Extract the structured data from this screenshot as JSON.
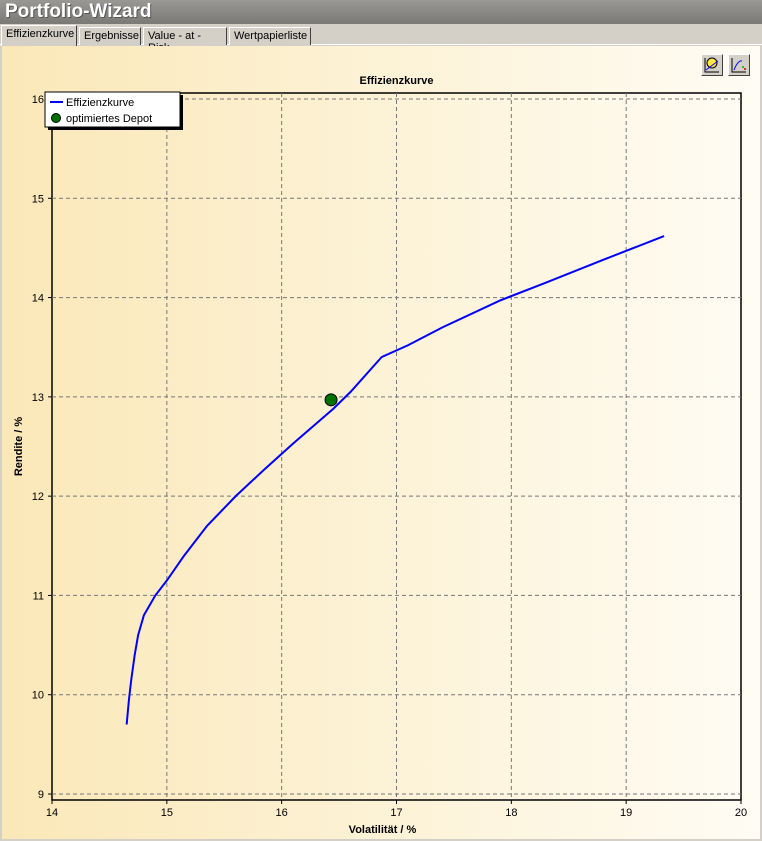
{
  "window": {
    "title": "Portfolio-Wizard"
  },
  "tabs": [
    {
      "label": "Effizienzkurve",
      "active": true
    },
    {
      "label": "Ergebnisse"
    },
    {
      "label": "Value - at - Risk"
    },
    {
      "label": "Wertpapierliste"
    }
  ],
  "toolbar": {
    "buttons": [
      {
        "icon": "chart-edit-icon"
      },
      {
        "icon": "chart-type-icon"
      }
    ]
  },
  "colors": {
    "curve": "#0000ff",
    "marker": "#007000"
  },
  "chart_data": {
    "type": "line",
    "title": "Effizienzkurve",
    "xlabel": "Volatilität / %",
    "ylabel": "Rendite / %",
    "xlim": [
      14,
      20
    ],
    "ylim": [
      9,
      16
    ],
    "xticks": [
      "14",
      "15",
      "16",
      "17",
      "18",
      "19",
      "20"
    ],
    "yticks": [
      "9",
      "10",
      "11",
      "12",
      "13",
      "14",
      "15",
      "16"
    ],
    "grid": true,
    "legend": {
      "placement": "top-left",
      "entries": [
        "Effizienzkurve",
        "optimiertes Depot"
      ]
    },
    "series": [
      {
        "name": "Effizienzkurve",
        "type": "line",
        "x": [
          14.65,
          14.67,
          14.69,
          14.72,
          14.75,
          14.8,
          14.9,
          15.0,
          15.15,
          15.35,
          15.6,
          15.85,
          16.1,
          16.45,
          16.6,
          16.87,
          17.1,
          17.4,
          17.9,
          18.3,
          18.8,
          19.33
        ],
        "y": [
          9.7,
          9.95,
          10.15,
          10.4,
          10.6,
          10.8,
          11.0,
          11.15,
          11.4,
          11.7,
          12.0,
          12.27,
          12.53,
          12.88,
          13.05,
          13.4,
          13.52,
          13.7,
          13.97,
          14.15,
          14.38,
          14.62
        ]
      },
      {
        "name": "optimiertes Depot",
        "type": "scatter",
        "x": [
          16.43
        ],
        "y": [
          12.97
        ]
      }
    ]
  }
}
